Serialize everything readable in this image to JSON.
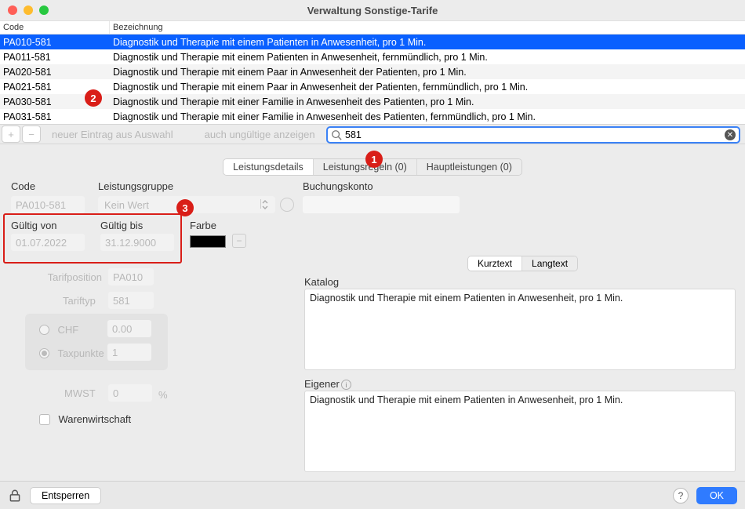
{
  "window": {
    "title": "Verwaltung Sonstige-Tarife"
  },
  "list": {
    "headers": {
      "code": "Code",
      "bez": "Bezeichnung"
    },
    "rows": [
      {
        "code": "PA010-581",
        "bez": "Diagnostik und Therapie mit einem Patienten in Anwesenheit, pro 1 Min."
      },
      {
        "code": "PA011-581",
        "bez": "Diagnostik und Therapie mit einem Patienten in Anwesenheit, fernmündlich, pro 1 Min."
      },
      {
        "code": "PA020-581",
        "bez": "Diagnostik und Therapie mit einem Paar in Anwesenheit der Patienten, pro 1 Min."
      },
      {
        "code": "PA021-581",
        "bez": "Diagnostik und Therapie mit einem Paar in Anwesenheit der Patienten, fernmündlich, pro 1 Min."
      },
      {
        "code": "PA030-581",
        "bez": "Diagnostik und Therapie mit einer Familie in Anwesenheit des Patienten, pro 1 Min."
      },
      {
        "code": "PA031-581",
        "bez": "Diagnostik und Therapie mit einer Familie in Anwesenheit des Patienten, fernmündlich, pro 1 Min."
      }
    ]
  },
  "toolbar": {
    "new_from_selection": "neuer Eintrag aus Auswahl",
    "show_invalid": "auch ungültige anzeigen",
    "search_value": "581"
  },
  "tabs": {
    "details": "Leistungsdetails",
    "rules": "Leistungsregeln (0)",
    "main": "Hauptleistungen (0)"
  },
  "form": {
    "labels": {
      "code": "Code",
      "group": "Leistungsgruppe",
      "account": "Buchungskonto",
      "valid_from": "Gültig von",
      "valid_to": "Gültig bis",
      "color": "Farbe",
      "tarifposition": "Tarifposition",
      "tariftyp": "Tariftyp",
      "chf": "CHF",
      "taxpunkte": "Taxpunkte",
      "mwst": "MWST",
      "percent": "%",
      "warenwirtschaft": "Warenwirtschaft",
      "katalog": "Katalog",
      "eigener": "Eigener",
      "kurztext": "Kurztext",
      "langtext": "Langtext"
    },
    "values": {
      "code": "PA010-581",
      "group": "Kein Wert",
      "account": "",
      "valid_from": "01.07.2022",
      "valid_to": "31.12.9000",
      "tarifposition": "PA010",
      "tariftyp": "581",
      "chf": "0.00",
      "taxpunkte": "1",
      "mwst": "0",
      "katalog_text": "Diagnostik und Therapie mit einem Patienten in Anwesenheit, pro 1 Min.",
      "eigener_text": "Diagnostik und Therapie mit einem Patienten in Anwesenheit, pro 1 Min."
    }
  },
  "annotations": {
    "badge1": "1",
    "badge2": "2",
    "badge3": "3"
  },
  "footer": {
    "unlock": "Entsperren",
    "ok": "OK",
    "help": "?"
  }
}
